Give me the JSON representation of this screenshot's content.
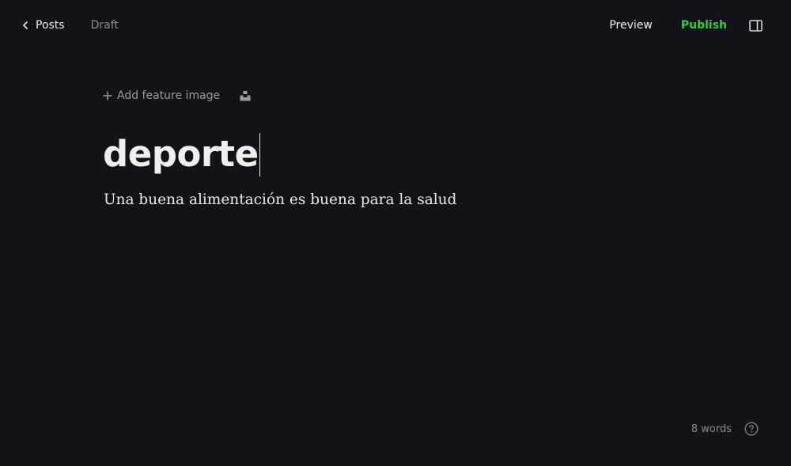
{
  "header": {
    "back_label": "Posts",
    "status": "Draft",
    "preview_label": "Preview",
    "publish_label": "Publish"
  },
  "feature_image": {
    "add_label": "Add feature image"
  },
  "post": {
    "title": "deporte",
    "body": "Una buena alimentación es buena para la salud"
  },
  "footer": {
    "word_count": "8 words"
  },
  "icons": {
    "back": "chevron-left-icon",
    "add": "plus-icon",
    "unsplash": "unsplash-icon",
    "sidebar": "sidebar-panel-icon",
    "help": "question-circle-icon"
  },
  "colors": {
    "background": "#121318",
    "publish": "#30cf43",
    "muted_text": "#8a8c93"
  }
}
